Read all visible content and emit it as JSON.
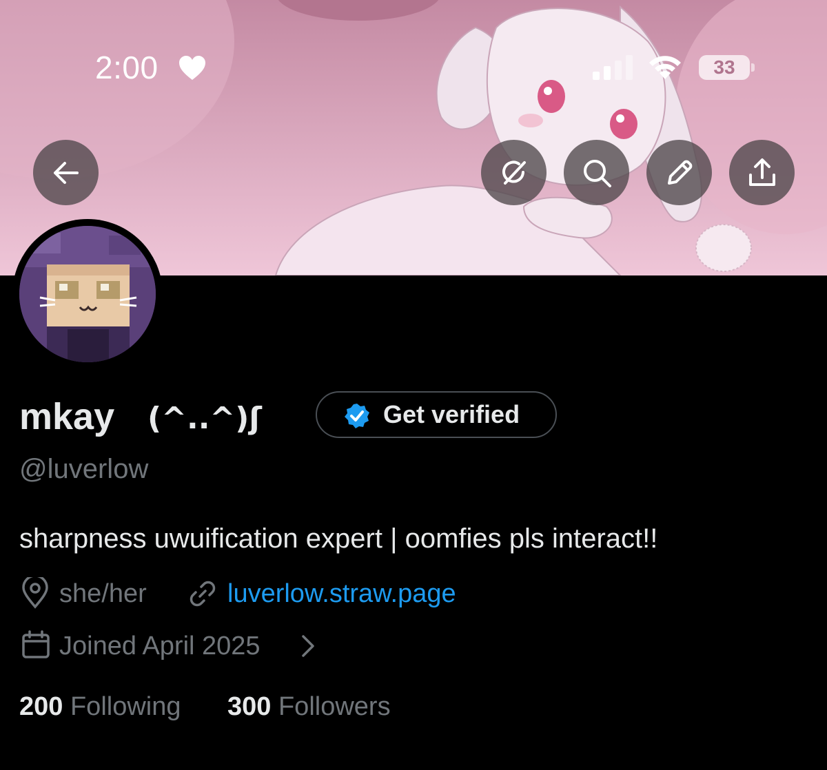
{
  "status_bar": {
    "time": "2:00",
    "battery_level": "33",
    "icons": [
      "heart-icon",
      "signal-icon",
      "wifi-icon",
      "battery-icon"
    ]
  },
  "header": {
    "buttons": [
      {
        "name": "back-button",
        "icon": "arrow-left-icon"
      },
      {
        "name": "grok-button",
        "icon": "grok-icon"
      },
      {
        "name": "search-button",
        "icon": "search-icon"
      },
      {
        "name": "edit-button",
        "icon": "pencil-icon"
      },
      {
        "name": "share-button",
        "icon": "share-icon"
      }
    ]
  },
  "profile": {
    "display_name": "mkay",
    "kaomoji": "(^..^)ʃ",
    "get_verified_label": "Get verified",
    "handle": "@luverlow",
    "bio": "sharpness uwuification expert | oomfies pls interact!!",
    "pronouns": "she/her",
    "website": "luverlow.straw.page",
    "joined": "Joined April 2025",
    "following_count": "200",
    "following_label": "Following",
    "followers_count": "300",
    "followers_label": "Followers"
  },
  "colors": {
    "background": "#000000",
    "primary_text": "#e7e9ea",
    "secondary_text": "#71767b",
    "link": "#1d9bf0",
    "verified_badge": "#1d9bf0",
    "banner_pink": "#d9a0b9"
  }
}
